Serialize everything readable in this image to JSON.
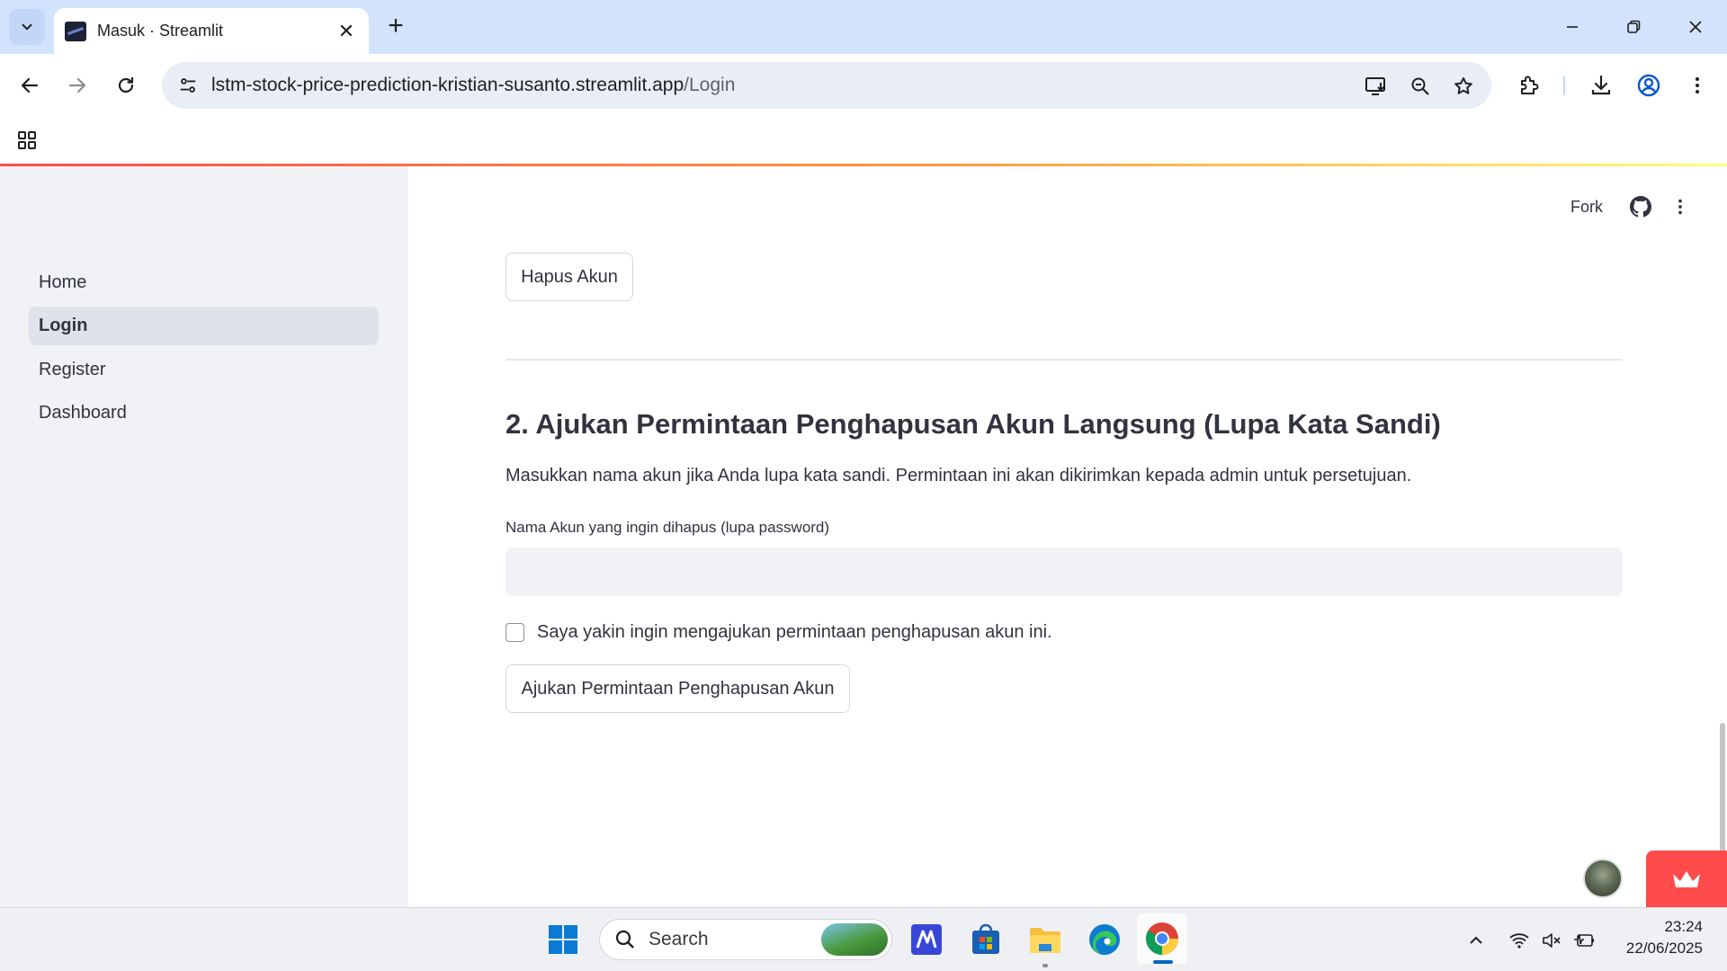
{
  "browser": {
    "tab_title": "Masuk · Streamlit",
    "url_host": "lstm-stock-price-prediction-kristian-susanto.streamlit.app",
    "url_path": "/Login"
  },
  "sidebar": {
    "items": [
      {
        "label": "Home",
        "active": false
      },
      {
        "label": "Login",
        "active": true
      },
      {
        "label": "Register",
        "active": false
      },
      {
        "label": "Dashboard",
        "active": false
      }
    ]
  },
  "header": {
    "fork_label": "Fork"
  },
  "main": {
    "delete_button_label": "Hapus Akun",
    "section_title": "2. Ajukan Permintaan Penghapusan Akun Langsung (Lupa Kata Sandi)",
    "section_description": "Masukkan nama akun jika Anda lupa kata sandi. Permintaan ini akan dikirimkan kepada admin untuk persetujuan.",
    "account_field_label": "Nama Akun yang ingin dihapus (lupa password)",
    "account_field_value": "",
    "confirm_checkbox_label": "Saya yakin ingin mengajukan permintaan penghapusan akun ini.",
    "confirm_checked": false,
    "submit_button_label": "Ajukan Permintaan Penghapusan Akun"
  },
  "taskbar": {
    "search_label": "Search",
    "time": "23:24",
    "date": "22/06/2025"
  },
  "colors": {
    "accent": "#ff4b4b",
    "sidebar_bg": "#f0f2f6",
    "tabbar_bg": "#d3e3fd"
  }
}
